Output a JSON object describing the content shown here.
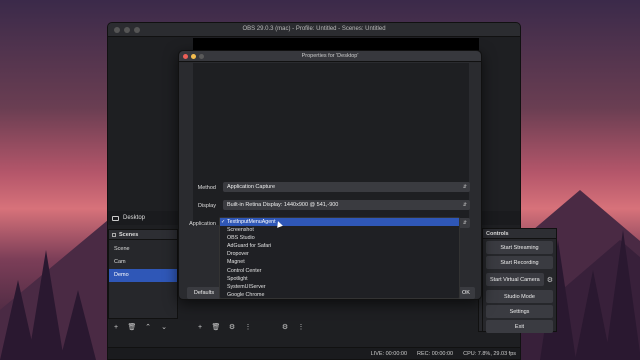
{
  "main_window": {
    "title": "OBS 29.0.3 (mac) - Profile: Untitled - Scenes: Untitled"
  },
  "source": {
    "name": "Desktop"
  },
  "scenes": {
    "header": "Scenes",
    "items": [
      {
        "label": "Scene",
        "selected": false
      },
      {
        "label": "Cam",
        "selected": false
      },
      {
        "label": "Demo",
        "selected": true
      }
    ]
  },
  "controls": {
    "header": "Controls",
    "start_streaming": "Start Streaming",
    "start_recording": "Start Recording",
    "start_virtual_camera": "Start Virtual Camera",
    "studio_mode": "Studio Mode",
    "settings": "Settings",
    "exit": "Exit"
  },
  "status": {
    "live": "LIVE: 00:00:00",
    "rec": "REC: 00:00:00",
    "cpu": "CPU: 7.8%, 29.03 fps"
  },
  "properties": {
    "title": "Properties for 'Desktop'",
    "method_label": "Method",
    "method_value": "Application Capture",
    "display_label": "Display",
    "display_value": "Built-in Retina Display: 1440x900 @ 541,-900",
    "application_label": "Application",
    "defaults_button": "Defaults",
    "ok_button": "OK"
  },
  "application_dropdown": {
    "options": [
      {
        "label": "TextInputMenuAgent",
        "selected": true
      },
      {
        "label": "Screenshot",
        "selected": false
      },
      {
        "label": "OBS Studio",
        "selected": false
      },
      {
        "label": "AdGuard for Safari",
        "selected": false
      },
      {
        "label": "Dropover",
        "selected": false
      },
      {
        "label": "Magnet",
        "selected": false
      },
      {
        "label": "Control Center",
        "selected": false
      },
      {
        "label": "Spotlight",
        "selected": false
      },
      {
        "label": "SystemUIServer",
        "selected": false
      },
      {
        "label": "Google Chrome",
        "selected": false
      }
    ]
  },
  "colors": {
    "accent": "#2f57b7",
    "window_bg": "#1e1f22"
  }
}
